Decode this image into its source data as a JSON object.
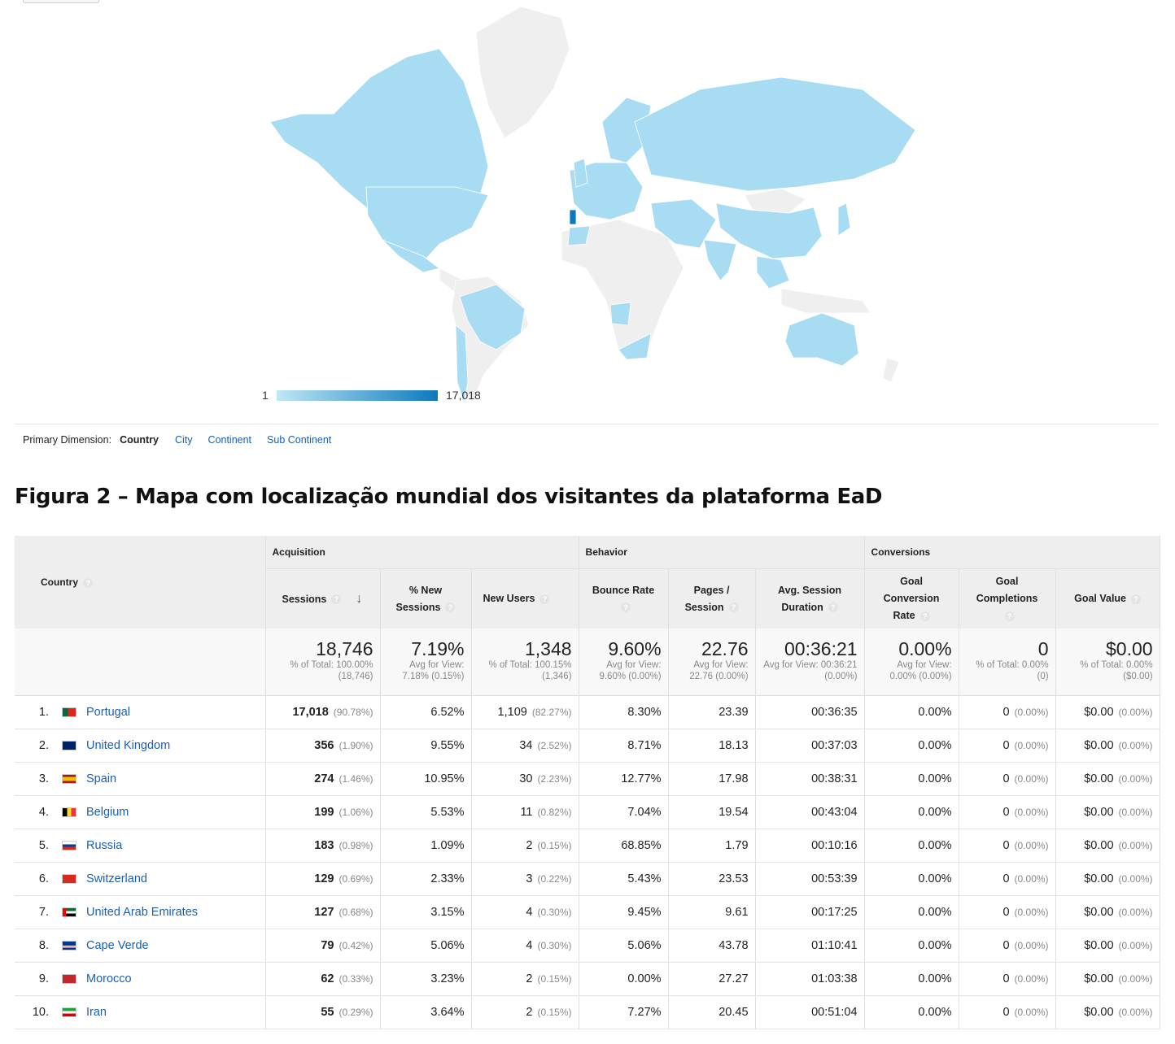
{
  "legend": {
    "min": "1",
    "max": "17,018"
  },
  "primary_dimension": {
    "label": "Primary Dimension:",
    "current": "Country",
    "options": [
      "City",
      "Continent",
      "Sub Continent"
    ]
  },
  "caption": "Figura 2 – Mapa com localização mundial dos visitantes da plataforma EaD",
  "table": {
    "groups": {
      "acquisition": "Acquisition",
      "behavior": "Behavior",
      "conversions": "Conversions"
    },
    "country_header": "Country",
    "columns": {
      "sessions": "Sessions",
      "new_sessions": "% New Sessions",
      "new_users": "New Users",
      "bounce": "Bounce Rate",
      "pages": "Pages / Session",
      "duration": "Avg. Session Duration",
      "conv_rate": "Goal Conversion Rate",
      "completions": "Goal Completions",
      "value": "Goal Value"
    },
    "totals": {
      "sessions": "18,746",
      "sessions_sub": "% of Total: 100.00% (18,746)",
      "new_sessions": "7.19%",
      "new_sessions_sub": "Avg for View: 7.18% (0.15%)",
      "new_users": "1,348",
      "new_users_sub": "% of Total: 100.15% (1,346)",
      "bounce": "9.60%",
      "bounce_sub": "Avg for View: 9.60% (0.00%)",
      "pages": "22.76",
      "pages_sub": "Avg for View: 22.76 (0.00%)",
      "duration": "00:36:21",
      "duration_sub": "Avg for View: 00:36:21 (0.00%)",
      "conv_rate": "0.00%",
      "conv_rate_sub": "Avg for View: 0.00% (0.00%)",
      "completions": "0",
      "completions_sub": "% of Total: 0.00% (0)",
      "value": "$0.00",
      "value_sub": "% of Total: 0.00% ($0.00)"
    },
    "rows": [
      {
        "idx": "1.",
        "flag": "portugal-flag",
        "country": "Portugal",
        "sessions": "17,018",
        "sessions_pct": "(90.78%)",
        "new_sessions": "6.52%",
        "new_users": "1,109",
        "new_users_pct": "(82.27%)",
        "bounce": "8.30%",
        "pages": "23.39",
        "duration": "00:36:35",
        "conv": "0.00%",
        "comp": "0",
        "comp_pct": "(0.00%)",
        "value": "$0.00",
        "value_pct": "(0.00%)"
      },
      {
        "idx": "2.",
        "flag": "uk-flag",
        "country": "United Kingdom",
        "sessions": "356",
        "sessions_pct": "(1.90%)",
        "new_sessions": "9.55%",
        "new_users": "34",
        "new_users_pct": "(2.52%)",
        "bounce": "8.71%",
        "pages": "18.13",
        "duration": "00:37:03",
        "conv": "0.00%",
        "comp": "0",
        "comp_pct": "(0.00%)",
        "value": "$0.00",
        "value_pct": "(0.00%)"
      },
      {
        "idx": "3.",
        "flag": "spain-flag",
        "country": "Spain",
        "sessions": "274",
        "sessions_pct": "(1.46%)",
        "new_sessions": "10.95%",
        "new_users": "30",
        "new_users_pct": "(2.23%)",
        "bounce": "12.77%",
        "pages": "17.98",
        "duration": "00:38:31",
        "conv": "0.00%",
        "comp": "0",
        "comp_pct": "(0.00%)",
        "value": "$0.00",
        "value_pct": "(0.00%)"
      },
      {
        "idx": "4.",
        "flag": "belgium-flag",
        "country": "Belgium",
        "sessions": "199",
        "sessions_pct": "(1.06%)",
        "new_sessions": "5.53%",
        "new_users": "11",
        "new_users_pct": "(0.82%)",
        "bounce": "7.04%",
        "pages": "19.54",
        "duration": "00:43:04",
        "conv": "0.00%",
        "comp": "0",
        "comp_pct": "(0.00%)",
        "value": "$0.00",
        "value_pct": "(0.00%)"
      },
      {
        "idx": "5.",
        "flag": "russia-flag",
        "country": "Russia",
        "sessions": "183",
        "sessions_pct": "(0.98%)",
        "new_sessions": "1.09%",
        "new_users": "2",
        "new_users_pct": "(0.15%)",
        "bounce": "68.85%",
        "pages": "1.79",
        "duration": "00:10:16",
        "conv": "0.00%",
        "comp": "0",
        "comp_pct": "(0.00%)",
        "value": "$0.00",
        "value_pct": "(0.00%)"
      },
      {
        "idx": "6.",
        "flag": "switzerland-flag",
        "country": "Switzerland",
        "sessions": "129",
        "sessions_pct": "(0.69%)",
        "new_sessions": "2.33%",
        "new_users": "3",
        "new_users_pct": "(0.22%)",
        "bounce": "5.43%",
        "pages": "23.53",
        "duration": "00:53:39",
        "conv": "0.00%",
        "comp": "0",
        "comp_pct": "(0.00%)",
        "value": "$0.00",
        "value_pct": "(0.00%)"
      },
      {
        "idx": "7.",
        "flag": "uae-flag",
        "country": "United Arab Emirates",
        "sessions": "127",
        "sessions_pct": "(0.68%)",
        "new_sessions": "3.15%",
        "new_users": "4",
        "new_users_pct": "(0.30%)",
        "bounce": "9.45%",
        "pages": "9.61",
        "duration": "00:17:25",
        "conv": "0.00%",
        "comp": "0",
        "comp_pct": "(0.00%)",
        "value": "$0.00",
        "value_pct": "(0.00%)"
      },
      {
        "idx": "8.",
        "flag": "cape-verde-flag",
        "country": "Cape Verde",
        "sessions": "79",
        "sessions_pct": "(0.42%)",
        "new_sessions": "5.06%",
        "new_users": "4",
        "new_users_pct": "(0.30%)",
        "bounce": "5.06%",
        "pages": "43.78",
        "duration": "01:10:41",
        "conv": "0.00%",
        "comp": "0",
        "comp_pct": "(0.00%)",
        "value": "$0.00",
        "value_pct": "(0.00%)"
      },
      {
        "idx": "9.",
        "flag": "morocco-flag",
        "country": "Morocco",
        "sessions": "62",
        "sessions_pct": "(0.33%)",
        "new_sessions": "3.23%",
        "new_users": "2",
        "new_users_pct": "(0.15%)",
        "bounce": "0.00%",
        "pages": "27.27",
        "duration": "01:03:38",
        "conv": "0.00%",
        "comp": "0",
        "comp_pct": "(0.00%)",
        "value": "$0.00",
        "value_pct": "(0.00%)"
      },
      {
        "idx": "10.",
        "flag": "iran-flag",
        "country": "Iran",
        "sessions": "55",
        "sessions_pct": "(0.29%)",
        "new_sessions": "3.64%",
        "new_users": "2",
        "new_users_pct": "(0.15%)",
        "bounce": "7.27%",
        "pages": "20.45",
        "duration": "00:51:04",
        "conv": "0.00%",
        "comp": "0",
        "comp_pct": "(0.00%)",
        "value": "$0.00",
        "value_pct": "(0.00%)"
      }
    ]
  }
}
